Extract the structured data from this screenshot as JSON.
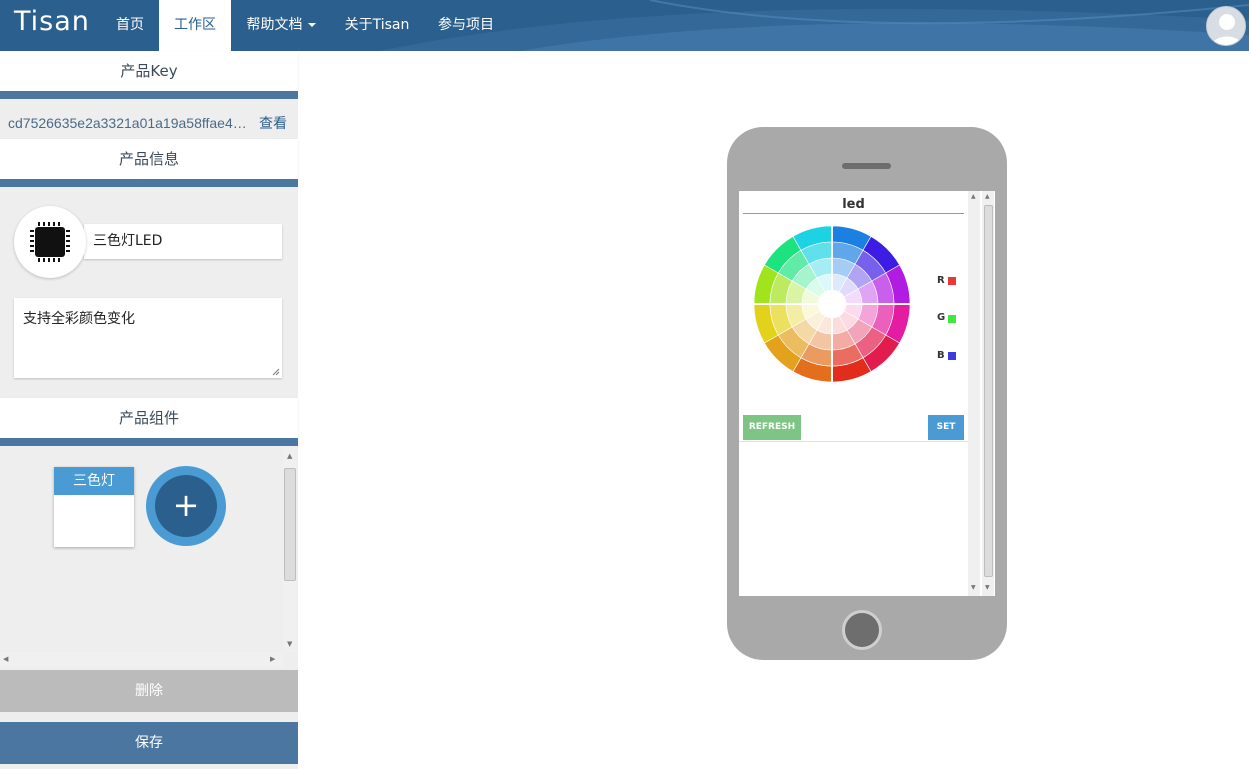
{
  "navbar": {
    "brand": "Tisan",
    "items": [
      {
        "label": "首页"
      },
      {
        "label": "工作区",
        "active": true
      },
      {
        "label": "帮助文档",
        "dropdown": true
      },
      {
        "label": "关于Tisan"
      },
      {
        "label": "参与项目"
      }
    ],
    "avatar_icon": "user-avatar-icon",
    "colors": {
      "navbar": "#2b5f8e",
      "accent": "#4a76a0",
      "component_blue": "#4a9ad4"
    }
  },
  "left_panel": {
    "product_key": {
      "title": "产品Key",
      "value": "cd7526635e2a3321a01a19a58ffae4…",
      "view_link": "查看"
    },
    "product_info": {
      "title": "产品信息",
      "icon": "chip-icon",
      "name_value": "三色灯LED",
      "description_value": "支持全彩颜色变化"
    },
    "components": {
      "title": "产品组件",
      "items": [
        {
          "label": "三色灯"
        }
      ],
      "add_label": "+"
    },
    "delete_label": "删除",
    "save_label": "保存"
  },
  "phone": {
    "widget": {
      "title": "led",
      "channels": [
        {
          "label": "R",
          "color": "#e53935"
        },
        {
          "label": "G",
          "color": "#3ee83e"
        },
        {
          "label": "B",
          "color": "#3b3be0"
        }
      ],
      "refresh_label": "REFRESH",
      "set_label": "SET"
    }
  }
}
